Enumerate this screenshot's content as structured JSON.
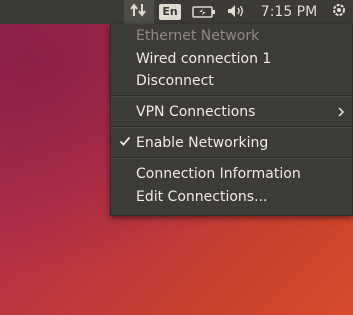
{
  "panel": {
    "keyboard_layout": "En",
    "clock": "7:15 PM",
    "icons": {
      "network": "network-arrows-icon",
      "battery": "battery-icon",
      "sound": "speaker-icon",
      "session": "power-gear-icon"
    }
  },
  "network_menu": {
    "header": "Ethernet Network",
    "connection": "Wired connection 1",
    "disconnect": "Disconnect",
    "vpn": "VPN Connections",
    "enable_networking": "Enable Networking",
    "enable_networking_checked": true,
    "connection_info": "Connection Information",
    "edit_connections": "Edit Connections..."
  },
  "colors": {
    "panel_bg": "#3c3b37",
    "menu_bg": "#3d3c38",
    "text": "#efece6",
    "disabled_text": "#8d8a82"
  }
}
